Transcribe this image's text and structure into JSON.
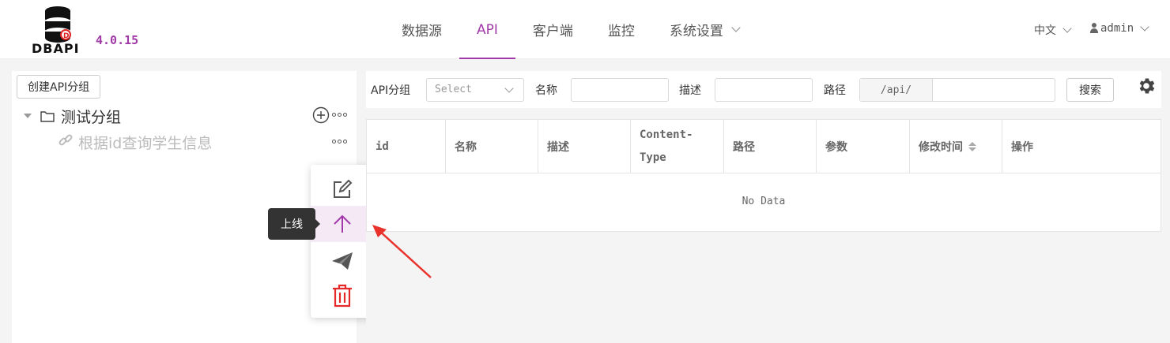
{
  "header": {
    "logo_text": "DBAPI",
    "version": "4.0.15",
    "nav": [
      {
        "label": "数据源",
        "active": false
      },
      {
        "label": "API",
        "active": true
      },
      {
        "label": "客户端",
        "active": false
      },
      {
        "label": "监控",
        "active": false
      },
      {
        "label": "系统设置",
        "active": false,
        "has_dropdown": true
      }
    ],
    "language": "中文",
    "user": "admin"
  },
  "sidebar": {
    "create_group_label": "创建API分组",
    "group_label": "测试分组",
    "api_label": "根据id查询学生信息",
    "popover": {
      "items": [
        "edit-icon",
        "arrow-up-icon",
        "paper-plane-icon",
        "trash-icon"
      ],
      "hovered_tooltip": "上线"
    }
  },
  "filter": {
    "group_label": "API分组",
    "group_placeholder": "Select",
    "name_label": "名称",
    "desc_label": "描述",
    "path_label": "路径",
    "path_prefix": "/api/",
    "search_label": "搜索"
  },
  "table": {
    "columns": [
      "id",
      "名称",
      "描述",
      "Content-Type",
      "路径",
      "参数",
      "修改时间",
      "操作"
    ],
    "empty_text": "No Data"
  },
  "colors": {
    "accent": "#a13aa8",
    "danger": "#e5292a",
    "annotation_arrow": "#e8322b"
  }
}
